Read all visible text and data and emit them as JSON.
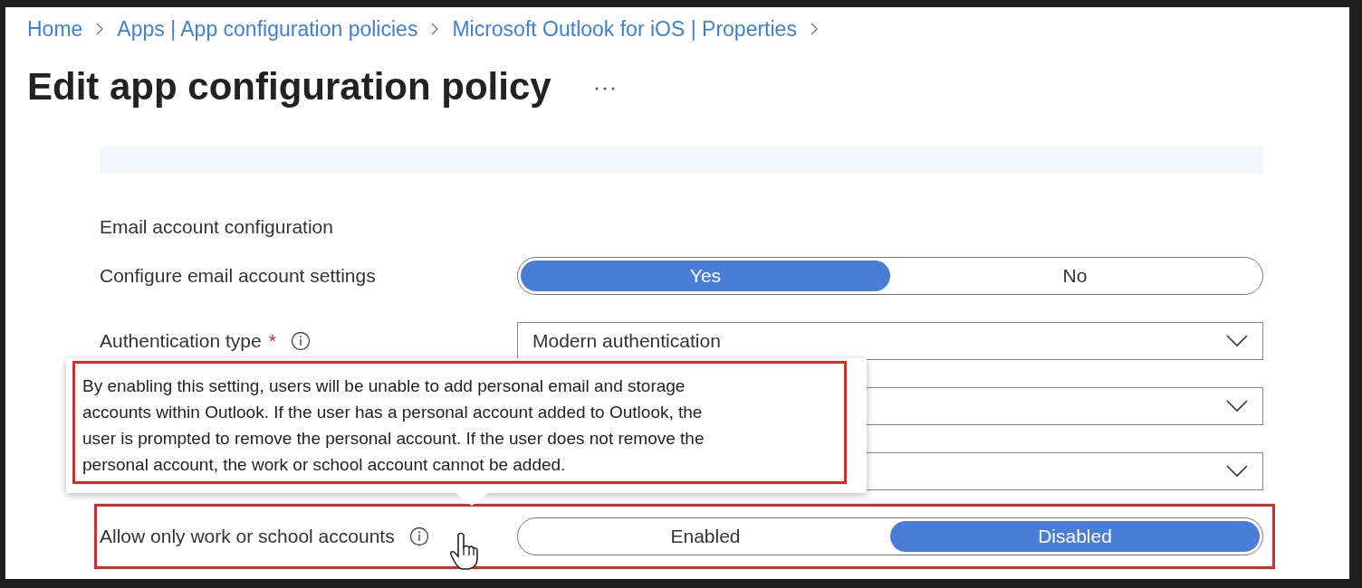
{
  "breadcrumb": [
    {
      "label": "Home"
    },
    {
      "label": "Apps | App configuration policies"
    },
    {
      "label": "Microsoft Outlook for iOS | Properties"
    }
  ],
  "title": "Edit app configuration policy",
  "settings": [
    {
      "kind": "heading",
      "label": "Email account configuration"
    },
    {
      "kind": "toggle",
      "label": "Configure email account settings",
      "highlighted": false,
      "options": [
        {
          "label": "Yes",
          "selected": true
        },
        {
          "label": "No",
          "selected": false
        }
      ]
    },
    {
      "kind": "dropdown",
      "label": "Authentication type",
      "required_mark": "*",
      "info": true,
      "value": "Modern authentication"
    },
    {
      "kind": "dropdown"
    },
    {
      "kind": "dropdown"
    },
    {
      "kind": "toggle",
      "label": "Allow only work or school accounts",
      "highlighted": true,
      "info": true,
      "options": [
        {
          "label": "Enabled",
          "selected": false
        },
        {
          "label": "Disabled",
          "selected": true
        }
      ]
    }
  ],
  "tooltip": {
    "text": "By enabling this setting, users will be unable to add personal email and storage accounts within Outlook. If the user has a personal account added to Outlook, the user is prompted to remove the personal account. If the user does not remove the personal account, the work or school account cannot be added.",
    "highlighted": true
  }
}
